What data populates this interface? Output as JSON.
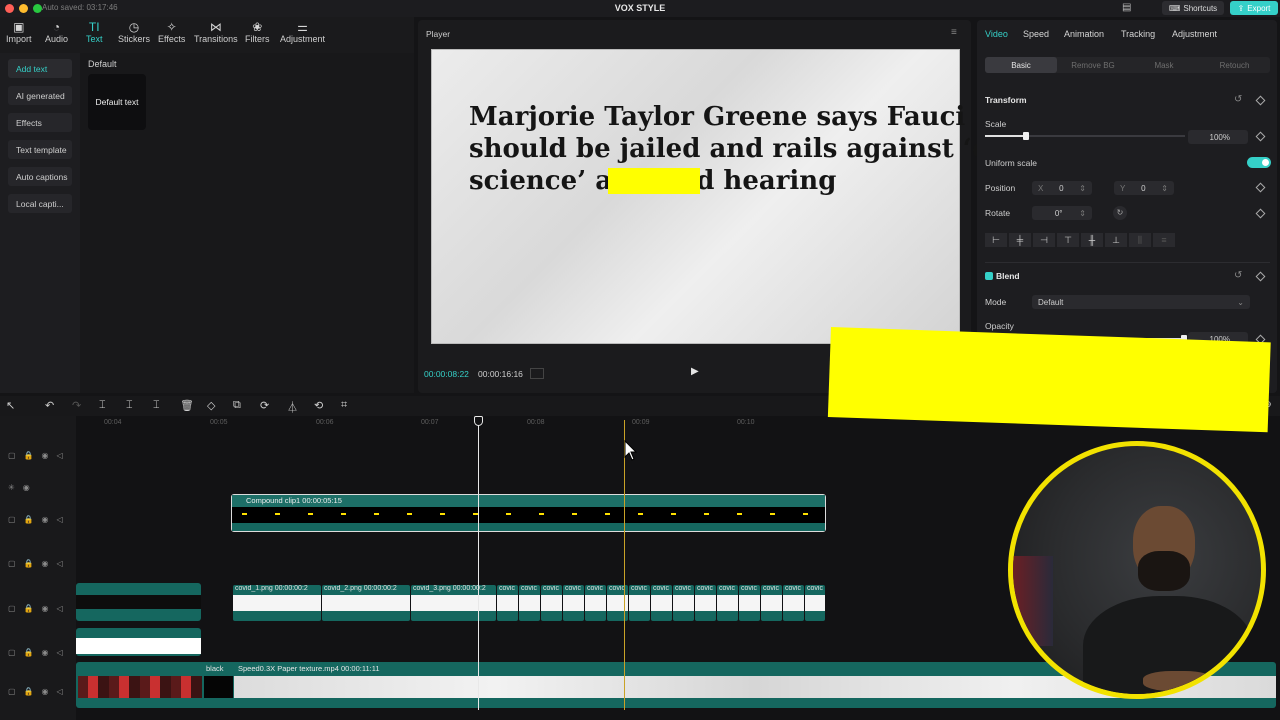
{
  "titlebar": {
    "autosave": "Auto saved: 03:17:46",
    "title": "VOX STYLE",
    "shortcuts": "Shortcuts",
    "export": "Export"
  },
  "toolbar": [
    {
      "label": "Import",
      "icon": "▣"
    },
    {
      "label": "Audio",
      "icon": "◔"
    },
    {
      "label": "Text",
      "icon": "TI"
    },
    {
      "label": "Stickers",
      "icon": "◷"
    },
    {
      "label": "Effects",
      "icon": "✧"
    },
    {
      "label": "Transitions",
      "icon": "⋈"
    },
    {
      "label": "Filters",
      "icon": "❀"
    },
    {
      "label": "Adjustment",
      "icon": "⚌"
    }
  ],
  "sidebar": [
    "Add text",
    "AI generated",
    "Effects",
    "Text template",
    "Auto captions",
    "Local capti..."
  ],
  "content": {
    "heading": "Default",
    "card": "Default text"
  },
  "player": {
    "title": "Player",
    "headline": [
      "Marjorie Taylor Greene says Fauci",
      "should be jailed and rails against ‘evil",
      "science’ at Covid hearing"
    ],
    "current_time": "00:00:08:22",
    "total_time": "00:00:16:16"
  },
  "inspector": {
    "tabs": [
      "Video",
      "Speed",
      "Animation",
      "Tracking",
      "Adjustment"
    ],
    "subtabs": [
      "Basic",
      "Remove BG",
      "Mask",
      "Retouch"
    ],
    "transform": "Transform",
    "scale_label": "Scale",
    "scale_value": "100%",
    "uniform_scale": "Uniform scale",
    "position_label": "Position",
    "pos_x_label": "X",
    "pos_x": "0",
    "pos_y_label": "Y",
    "pos_y": "0",
    "rotate_label": "Rotate",
    "rotate_value": "0°",
    "blend": "Blend",
    "mode_label": "Mode",
    "mode_value": "Default",
    "opacity_label": "Opacity",
    "opacity_value": "100%"
  },
  "timeline": {
    "ticks": [
      "00:04",
      "00:05",
      "00:06",
      "00:07",
      "00:08",
      "00:09",
      "00:10"
    ],
    "compound_clip": "Compound clip1  00:00:05:15",
    "png_clips": [
      "covid_1.png  00:00:00:2",
      "covid_2.png  00:00:00:2",
      "covid_3.png  00:00:00:2",
      "covic",
      "covic",
      "covic",
      "covic",
      "covic",
      "covic",
      "covic",
      "covic",
      "covic",
      "covic",
      "covic",
      "covic",
      "covic",
      "covic",
      "covic"
    ],
    "black_label": "black",
    "paper_clip": "Speed0.3X  Paper texture.mp4  00:00:11:11"
  },
  "colors": {
    "accent": "#35d0c8",
    "clip": "#15675f",
    "highlight": "#ffff00"
  }
}
